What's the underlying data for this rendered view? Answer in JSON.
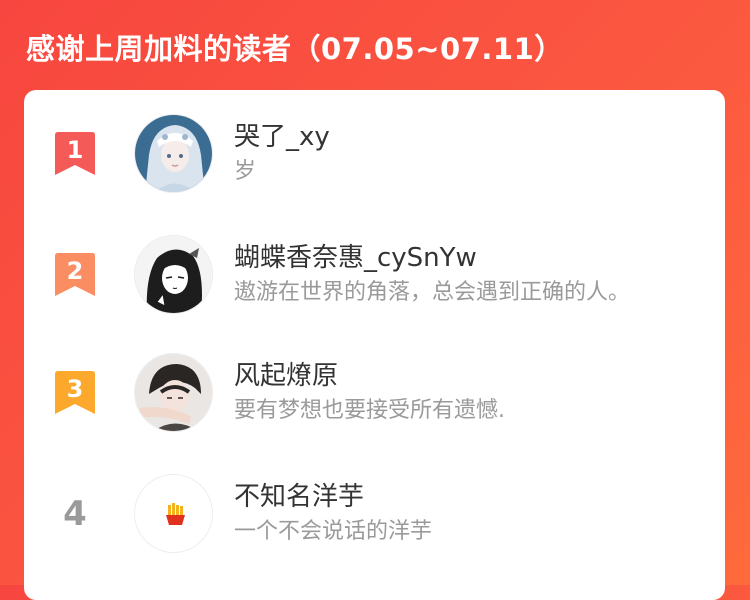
{
  "header": {
    "title": "感谢上周加料的读者（07.05~07.11）"
  },
  "readers": [
    {
      "rank": "1",
      "name": "哭了_xy",
      "signature": "岁",
      "badge_color": "#f45a57",
      "avatar_icon": "anime-girl-avatar"
    },
    {
      "rank": "2",
      "name": "蝴蝶香奈惠_cySnYw",
      "signature": "遨游在世界的角落，总会遇到正确的人。",
      "badge_color": "#fb8d63",
      "avatar_icon": "manga-girl-avatar"
    },
    {
      "rank": "3",
      "name": "风起燎原",
      "signature": "要有梦想也要接受所有遗憾.",
      "badge_color": "#fba82c",
      "avatar_icon": "anime-boy-avatar"
    },
    {
      "rank": "4",
      "name": "不知名洋芋",
      "signature": "一个不会说话的洋芋",
      "badge_color": "",
      "avatar_icon": "fries-avatar"
    }
  ],
  "colors": {
    "background": "#f7463f",
    "card": "#ffffff",
    "name_text": "#333333",
    "signature_text": "#9a9a9a"
  }
}
